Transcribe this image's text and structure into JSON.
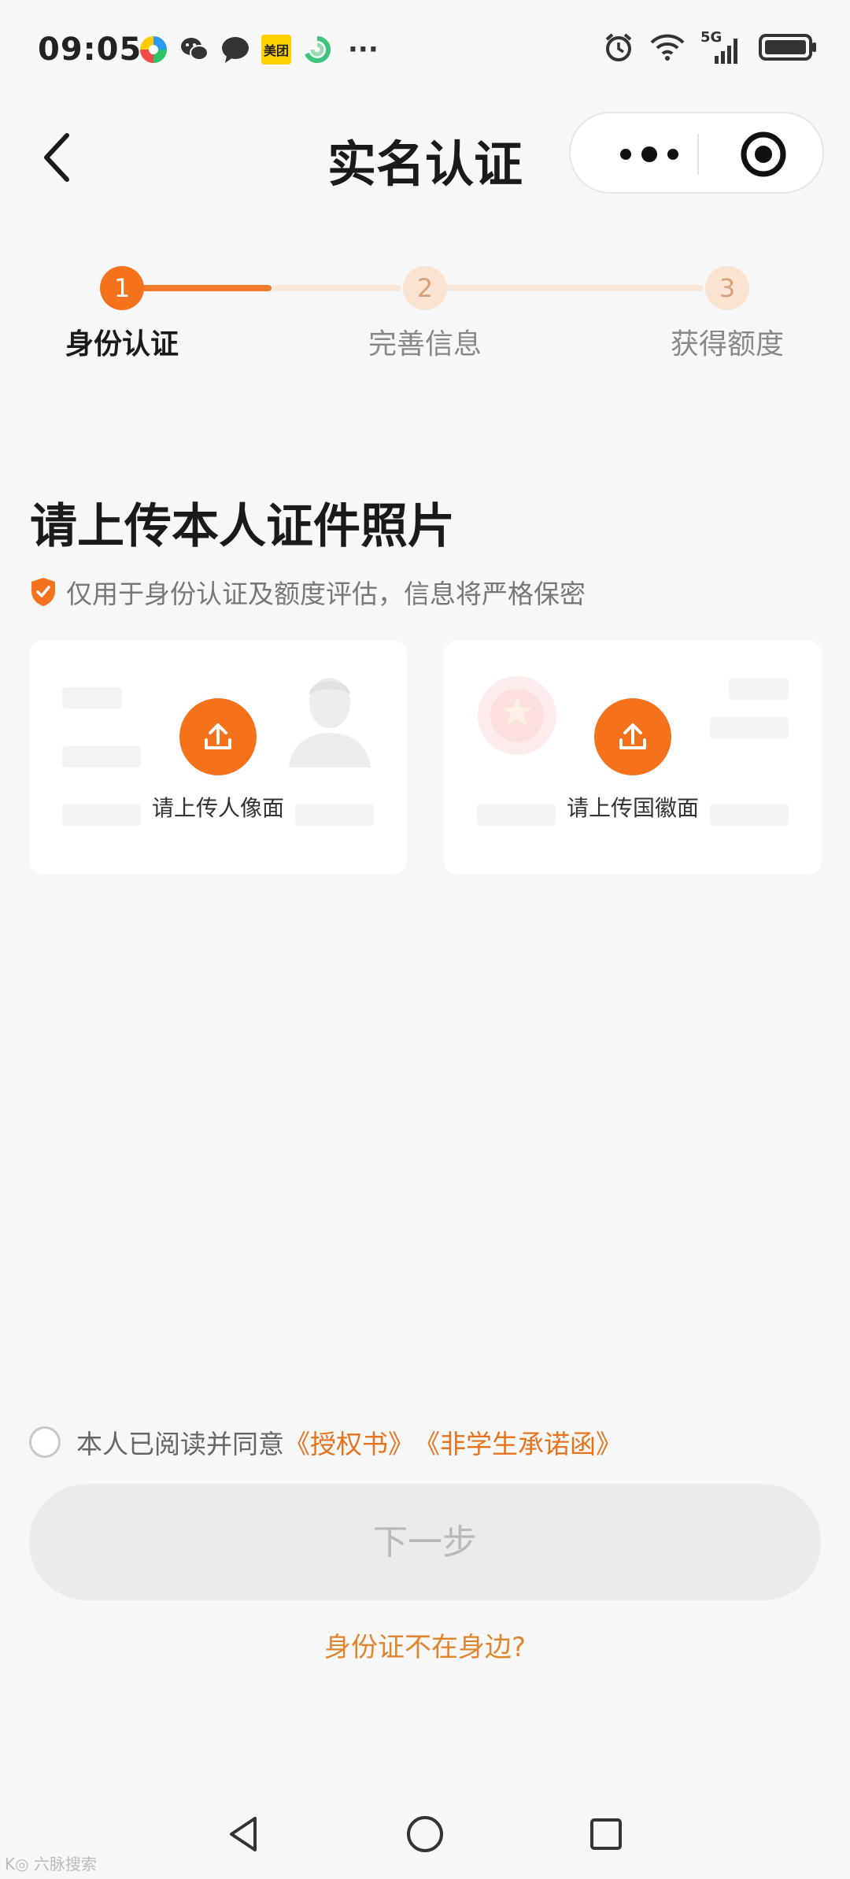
{
  "status_bar": {
    "time": "09:05",
    "meituan_label": "美团",
    "more": "···",
    "network": "5G"
  },
  "nav": {
    "title": "实名认证"
  },
  "steps": [
    {
      "number": "1",
      "label": "身份认证",
      "state": "active"
    },
    {
      "number": "2",
      "label": "完善信息",
      "state": "pending"
    },
    {
      "number": "3",
      "label": "获得额度",
      "state": "pending"
    }
  ],
  "main": {
    "heading": "请上传本人证件照片",
    "privacy_note": "仅用于身份认证及额度评估，信息将严格保密",
    "cards": [
      {
        "label": "请上传人像面"
      },
      {
        "label": "请上传国徽面"
      }
    ]
  },
  "agreement": {
    "prefix": "本人已阅读并同意",
    "link1": "《授权书》",
    "link2": "《非学生承诺函》"
  },
  "next_button": "下一步",
  "no_id_link": "身份证不在身边?",
  "watermark": "K◎ 六脉搜索",
  "colors": {
    "accent": "#f5721d",
    "link": "#e5731e",
    "disabled_button": "#ebebeb"
  }
}
